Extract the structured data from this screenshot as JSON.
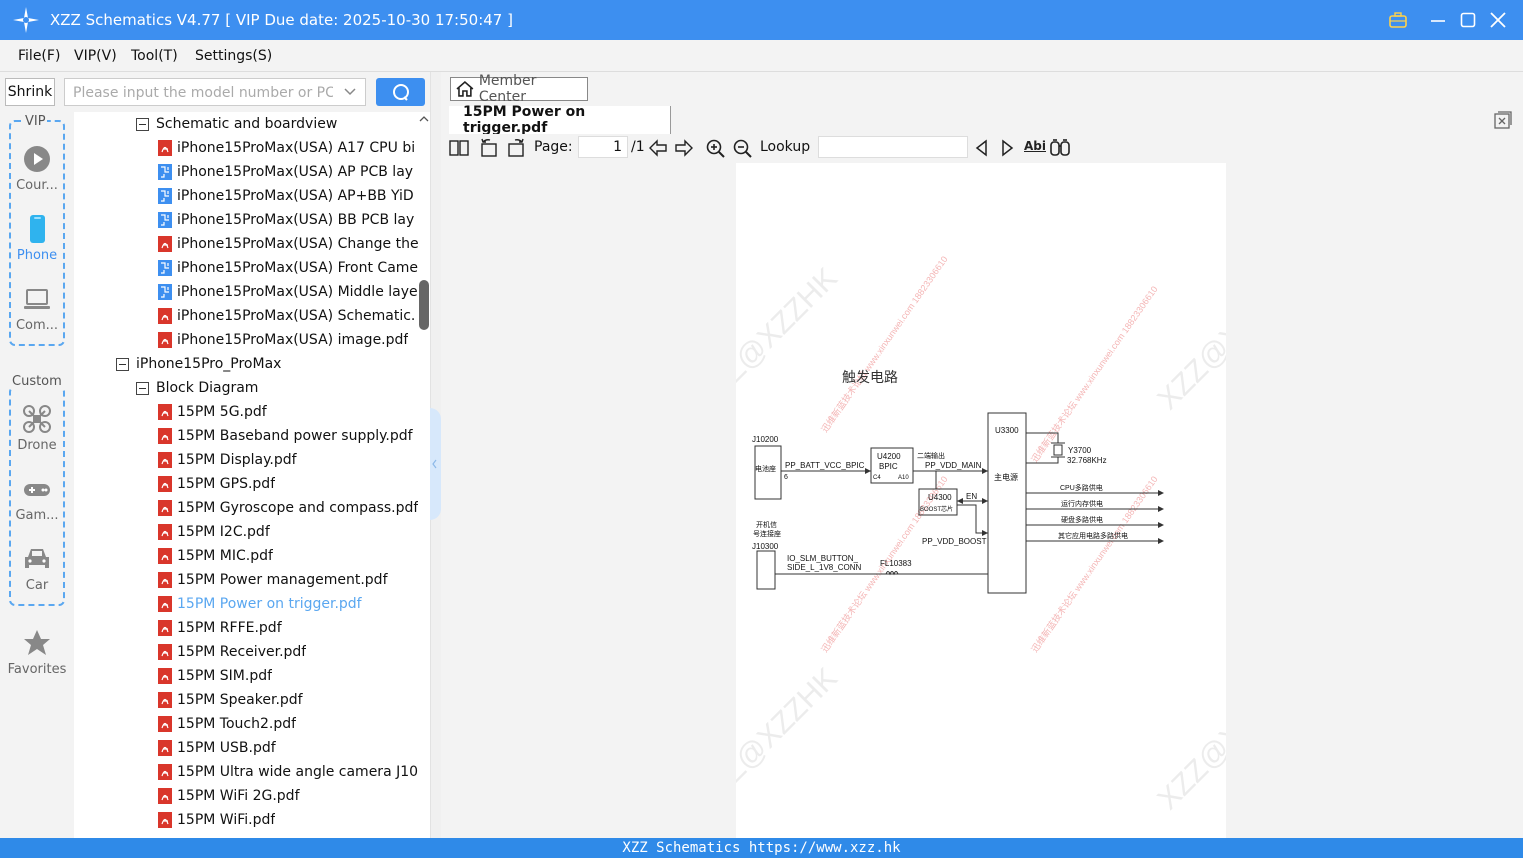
{
  "window": {
    "title": "XZZ Schematics V4.77 [ VIP Due date: 2025-10-30 17:50:47 ]"
  },
  "menu": {
    "items": [
      "File(F)",
      "VIP(V)",
      "Tool(T)",
      "Settings(S)"
    ]
  },
  "search": {
    "shrink_label": "Shrink",
    "placeholder": "Please input the model number or PCB"
  },
  "categories": {
    "vip_title": "VIP",
    "custom_title": "Custom",
    "items": [
      {
        "label": "Cour...",
        "icon": "play-circle-icon"
      },
      {
        "label": "Phone",
        "icon": "phone-icon",
        "active": true
      },
      {
        "label": "Com...",
        "icon": "laptop-icon"
      },
      {
        "label": "Drone",
        "icon": "drone-icon"
      },
      {
        "label": "Gam...",
        "icon": "gamepad-icon"
      },
      {
        "label": "Car",
        "icon": "car-icon"
      },
      {
        "label": "Favorites",
        "icon": "star-icon"
      }
    ]
  },
  "tree": {
    "rows": [
      {
        "label": "Schematic and boardview",
        "type": "folder",
        "level": 2
      },
      {
        "label": "iPhone15ProMax(USA) A17 CPU bi",
        "type": "pdf",
        "level": 3
      },
      {
        "label": "iPhone15ProMax(USA) AP PCB lay",
        "type": "pcb",
        "level": 3
      },
      {
        "label": "iPhone15ProMax(USA) AP+BB YiD",
        "type": "pcb",
        "level": 3
      },
      {
        "label": "iPhone15ProMax(USA) BB PCB lay",
        "type": "pcb",
        "level": 3
      },
      {
        "label": "iPhone15ProMax(USA) Change the",
        "type": "pdf",
        "level": 3
      },
      {
        "label": "iPhone15ProMax(USA) Front Came",
        "type": "pcb",
        "level": 3
      },
      {
        "label": "iPhone15ProMax(USA) Middle laye",
        "type": "pcb",
        "level": 3
      },
      {
        "label": "iPhone15ProMax(USA) Schematic.",
        "type": "pdf",
        "level": 3
      },
      {
        "label": "iPhone15ProMax(USA) image.pdf",
        "type": "pdf",
        "level": 3
      },
      {
        "label": "iPhone15Pro_ProMax",
        "type": "folder",
        "level": 1
      },
      {
        "label": "Block Diagram",
        "type": "folder",
        "level": 2
      },
      {
        "label": "15PM 5G.pdf",
        "type": "pdf",
        "level": 3
      },
      {
        "label": "15PM Baseband power supply.pdf",
        "type": "pdf",
        "level": 3
      },
      {
        "label": "15PM Display.pdf",
        "type": "pdf",
        "level": 3
      },
      {
        "label": "15PM GPS.pdf",
        "type": "pdf",
        "level": 3
      },
      {
        "label": "15PM Gyroscope and compass.pdf",
        "type": "pdf",
        "level": 3
      },
      {
        "label": "15PM I2C.pdf",
        "type": "pdf",
        "level": 3
      },
      {
        "label": "15PM MIC.pdf",
        "type": "pdf",
        "level": 3
      },
      {
        "label": "15PM Power management.pdf",
        "type": "pdf",
        "level": 3
      },
      {
        "label": "15PM Power on trigger.pdf",
        "type": "pdf",
        "level": 3,
        "selected": true
      },
      {
        "label": "15PM RFFE.pdf",
        "type": "pdf",
        "level": 3
      },
      {
        "label": "15PM Receiver.pdf",
        "type": "pdf",
        "level": 3
      },
      {
        "label": "15PM SIM.pdf",
        "type": "pdf",
        "level": 3
      },
      {
        "label": "15PM Speaker.pdf",
        "type": "pdf",
        "level": 3
      },
      {
        "label": "15PM Touch2.pdf",
        "type": "pdf",
        "level": 3
      },
      {
        "label": "15PM USB.pdf",
        "type": "pdf",
        "level": 3
      },
      {
        "label": "15PM Ultra wide angle camera J10",
        "type": "pdf",
        "level": 3
      },
      {
        "label": "15PM WiFi 2G.pdf",
        "type": "pdf",
        "level": 3
      },
      {
        "label": "15PM WiFi.pdf",
        "type": "pdf",
        "level": 3
      }
    ]
  },
  "viewer": {
    "member_center": "Member Center",
    "tab_title": "15PM Power on trigger.pdf",
    "page_label": "Page:",
    "page_value": "1",
    "page_total": "/1",
    "lookup_label": "Lookup",
    "lookup_value": "",
    "abi_label": "Abi"
  },
  "schematic": {
    "title": "触发电路",
    "watermark_big": "XZZ@XZZHK",
    "watermark_small": "迅维新蓝技术论坛 www.xinxunwei.com 18823306610",
    "labels": {
      "j10200": "J10200",
      "battery": "电池座",
      "pin6": "6",
      "pp_batt": "PP_BATT_VCC_BPIC",
      "u4200": "U4200",
      "bpic": "BPIC",
      "c4": "C4",
      "a10": "A10",
      "two_out": "二端输出",
      "pp_vdd_main": "PP_VDD_MAIN",
      "u3300": "U3300",
      "main_pwr": "主电源",
      "y3700": "Y3700",
      "crystal": "32.768KHz",
      "u4300": "U4300",
      "boost": "BOOST芯片",
      "en": "EN",
      "pp_vdd_boost": "PP_VDD_BOOST",
      "power_btn_1": "开机信",
      "power_btn_2": "号连接座",
      "j10300": "J10300",
      "io_slm_1": "IO_SLM_BUTTON_",
      "io_slm_2": "SIDE_L_1V8_CONN",
      "fl10383": "FL10383",
      "out1": "CPU多路供电",
      "out2": "运行内存供电",
      "out3": "硬盘多路供电",
      "out4": "其它应用电路多路供电"
    }
  },
  "status": {
    "text": "XZZ Schematics https://www.xzz.hk"
  },
  "colors": {
    "accent": "#3d8ff0",
    "pdf_red": "#d9362b",
    "pcb_blue": "#3d8ff0",
    "selected_text": "#5aa7f0"
  }
}
